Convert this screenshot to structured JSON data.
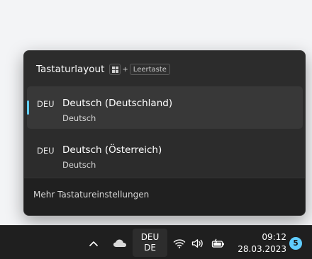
{
  "flyout": {
    "title": "Tastaturlayout",
    "shortcut_plus": "+",
    "shortcut_key": "Leertaste",
    "layouts": [
      {
        "code": "DEU",
        "name": "Deutsch (Deutschland)",
        "sub": "Deutsch",
        "selected": true
      },
      {
        "code": "DEU",
        "name": "Deutsch (Österreich)",
        "sub": "Deutsch",
        "selected": false
      }
    ],
    "footer_link": "Mehr Tastatureinstellungen"
  },
  "taskbar": {
    "lang_line1": "DEU",
    "lang_line2": "DE",
    "time": "09:12",
    "date": "28.03.2023",
    "notification_count": "5"
  },
  "colors": {
    "accent": "#60cdff",
    "flyout_bg": "#2c2c2c",
    "taskbar_bg": "#1f1f1f"
  },
  "icons": [
    "windows-logo-icon",
    "chevron-up-icon",
    "onedrive-cloud-icon",
    "wifi-icon",
    "volume-icon",
    "battery-icon"
  ]
}
